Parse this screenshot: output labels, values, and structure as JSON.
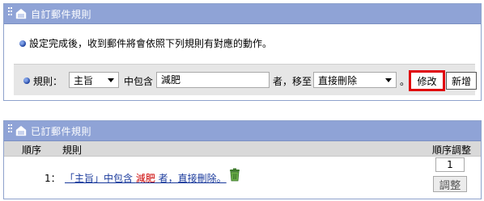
{
  "create_panel": {
    "title": "自訂郵件規則",
    "description": "設定完成後，收到郵件將會依照下列規則有對應的動作。",
    "rule_label": "規則：",
    "field_select": "主旨",
    "contains_label": "中包含",
    "keyword_value": "減肥",
    "move_to_label": "者，移至",
    "action_select": "直接刪除",
    "period": "。",
    "modify_button": "修改",
    "add_button": "新增"
  },
  "list_panel": {
    "title": "已訂郵件規則",
    "columns": {
      "order": "順序",
      "rule": "規則",
      "adjust": "順序調整"
    },
    "rows": [
      {
        "order": "1：",
        "rule_prefix": "「主旨」中包含 ",
        "keyword": "減肥",
        "rule_suffix": " 者，直接刪除。",
        "order_value": "1",
        "adjust_button": "調整"
      }
    ]
  },
  "colors": {
    "header_bg": "#8fa3d6",
    "highlight": "#e0000b",
    "link": "#1a3a9c",
    "keyword": "#cc0000"
  }
}
